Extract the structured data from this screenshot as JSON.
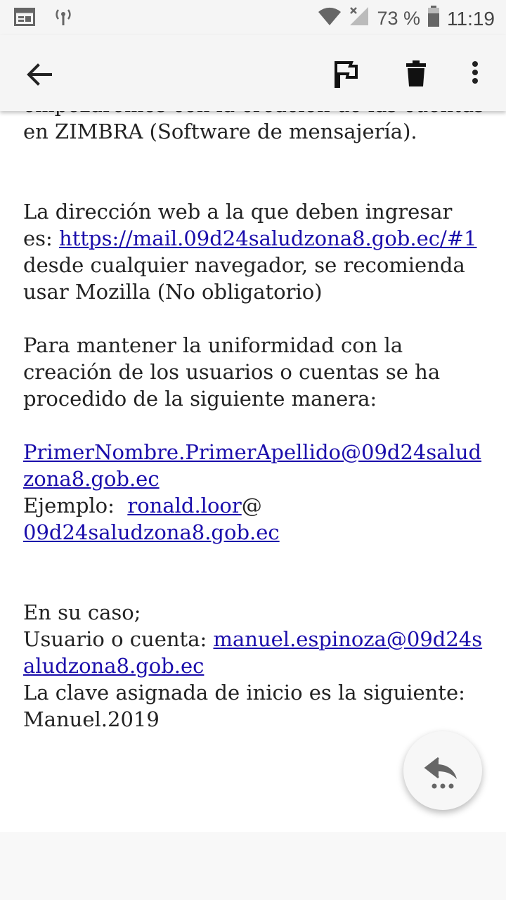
{
  "status_bar": {
    "battery": "73 %",
    "time": "11:19"
  },
  "email_body": {
    "cut_line": "empezaremos con la creación de las cuentas",
    "line_zimbra": "en ZIMBRA (Software de mensajería).",
    "web_intro": "La dirección web a la que deben ingresar es: ",
    "web_link": "https://mail.09d24saludzona8.gob.ec/#1",
    "web_after": " desde cualquier navegador, se recomienda usar Mozilla (No obligatorio)",
    "uniformity": "Para mantener la uniformidad con la creación de los usuarios o cuentas se ha procedido de la siguiente manera:",
    "pattern_link": "PrimerNombre.PrimerApellido@09d24saludzona8.gob.ec",
    "example_label": "Ejemplo:  ",
    "example_user": "ronald.loor",
    "example_at": "@",
    "example_domain": "09d24saludzona8.gob.ec",
    "case_label": "En su caso;",
    "user_label": "Usuario o cuenta: ",
    "user_link": "manuel.espinoza@09d24saludzona8.gob.ec",
    "password_line": "La clave asignada de inicio es la siguiente:",
    "password": "Manuel.2019"
  },
  "colors": {
    "link": "#1a0dab",
    "appbar": "#f5f5f5"
  },
  "icons": {
    "back": "arrow-back-icon",
    "flag": "flag-icon",
    "trash": "trash-icon",
    "more": "more-vert-icon",
    "reply_all": "reply-all-icon"
  }
}
